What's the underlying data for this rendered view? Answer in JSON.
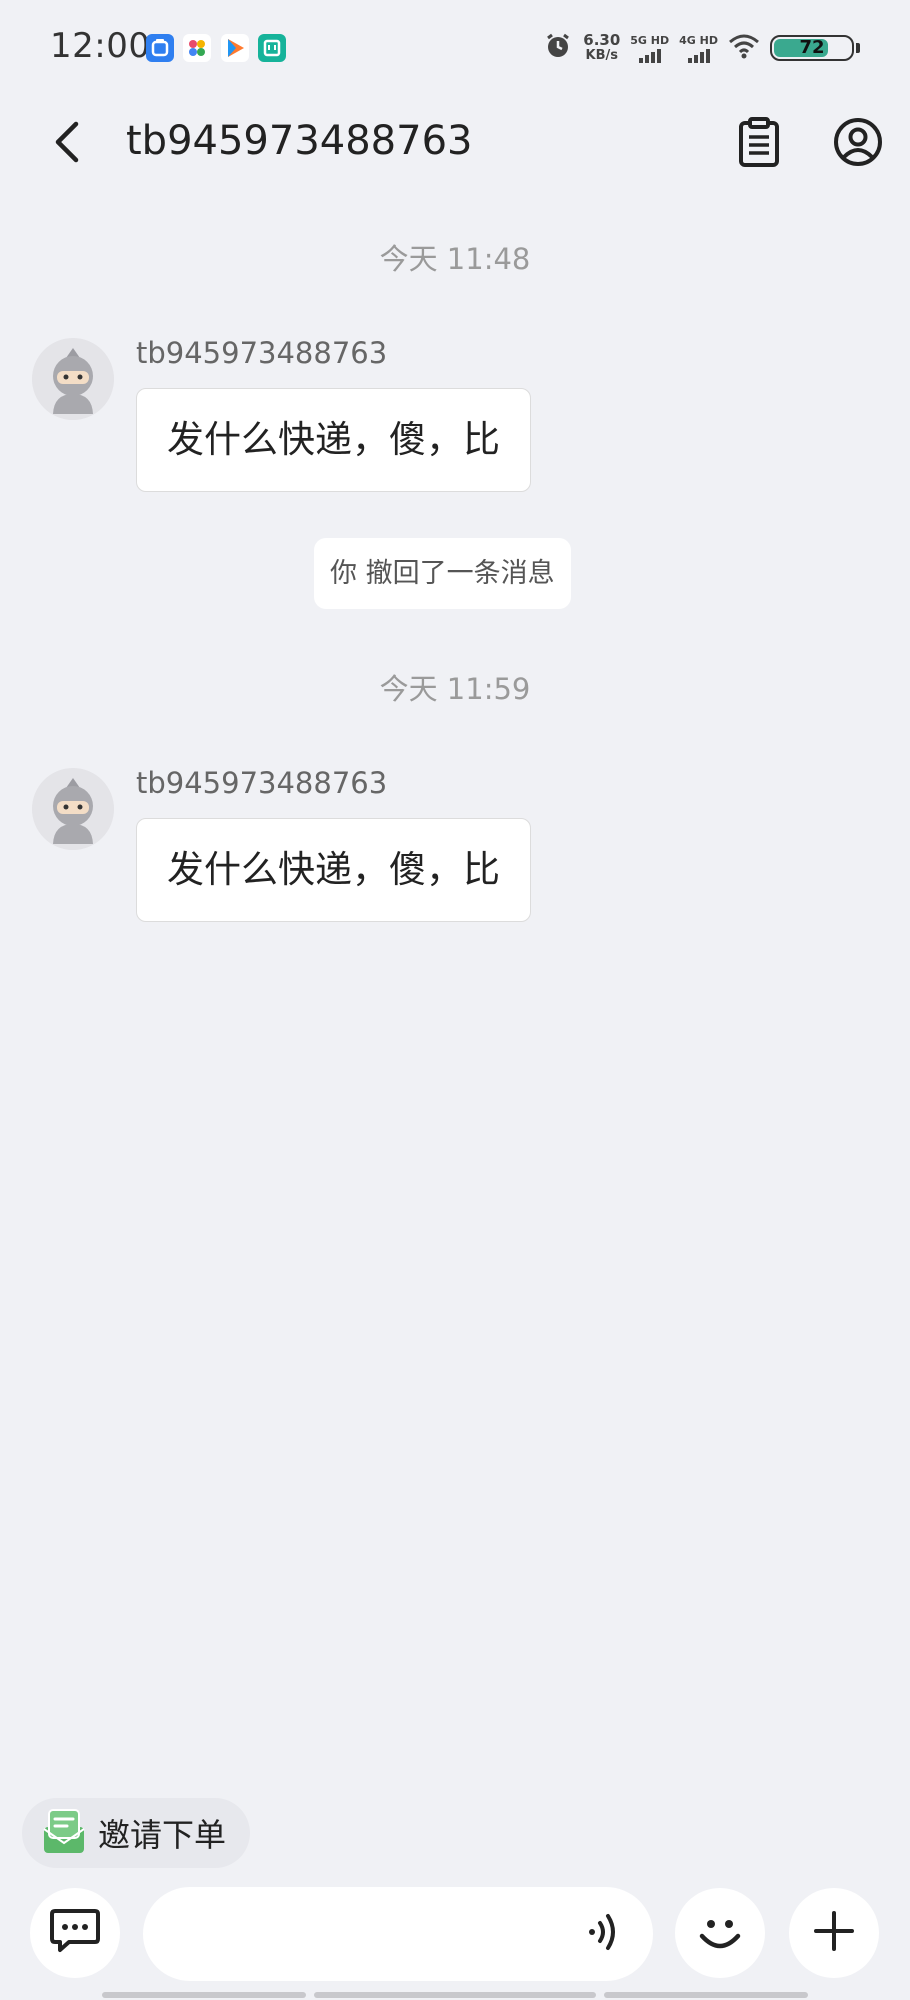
{
  "status_bar": {
    "time": "12:00",
    "net_speed_value": "6.30",
    "net_speed_unit": "KB/s",
    "sim1": "5G HD",
    "sim2": "4G HD",
    "battery": "72",
    "battery_level": 0.72,
    "app_icons": [
      "bubble-app-icon",
      "pinwheel-app-icon",
      "play-app-icon",
      "mi-app-icon"
    ]
  },
  "header": {
    "title": "tb945973488763",
    "icons": [
      "back-arrow-icon",
      "clipboard-icon",
      "user-icon"
    ]
  },
  "chat": {
    "messages": [
      {
        "type": "time",
        "text": "今天  11:48"
      },
      {
        "type": "incoming",
        "sender": "tb945973488763",
        "text": "发什么快递，傻，比"
      },
      {
        "type": "system",
        "text": "你 撤回了一条消息"
      },
      {
        "type": "time",
        "text": "今天  11:59"
      },
      {
        "type": "incoming",
        "sender": "tb945973488763",
        "text": "发什么快递，傻，比"
      }
    ]
  },
  "invite": {
    "label": "邀请下单",
    "icon": "order-invite-icon"
  },
  "input": {
    "value": "",
    "placeholder": ""
  },
  "colors": {
    "background": "#f0f1f5",
    "bubble": "#ffffff",
    "battery": "#3aa98f",
    "invite_icon": "#5cb86a"
  }
}
